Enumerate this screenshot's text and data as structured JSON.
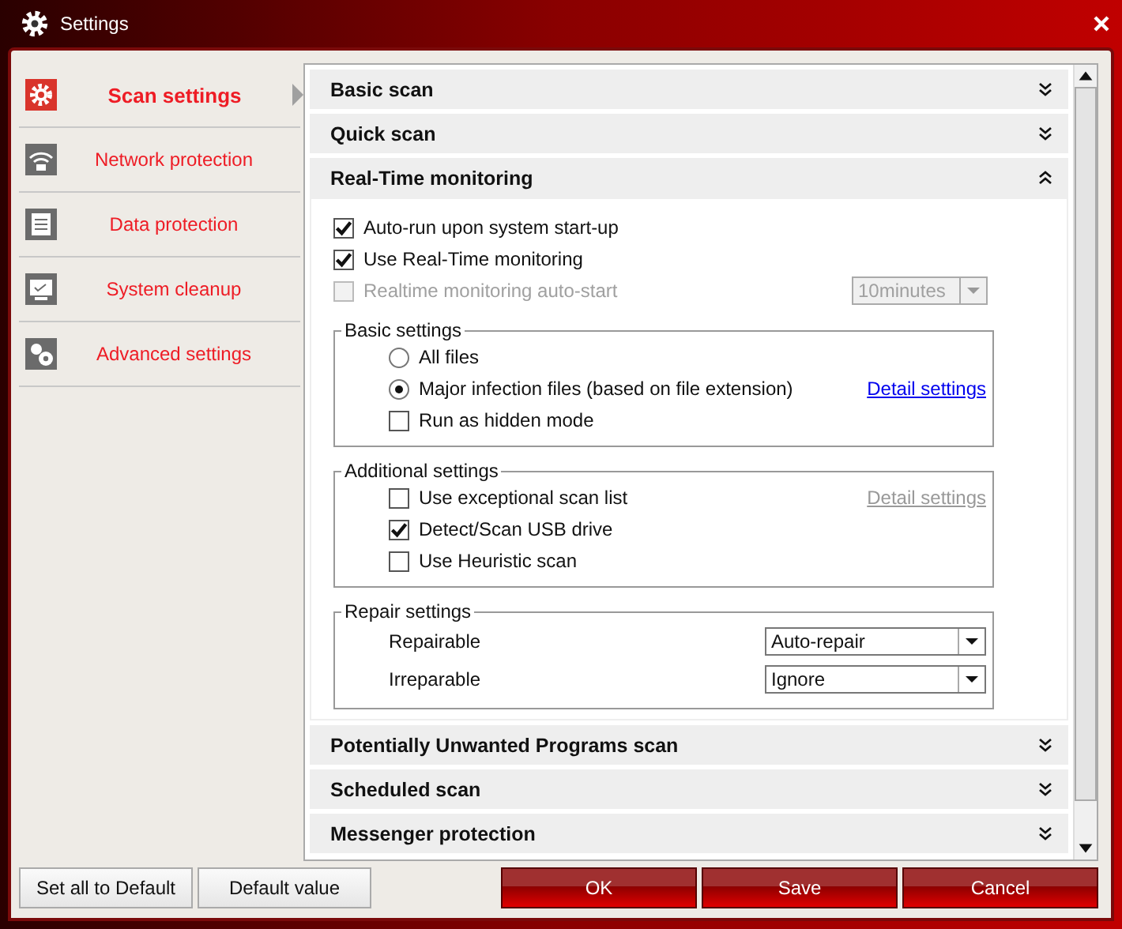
{
  "window": {
    "title": "Settings"
  },
  "sidebar": {
    "items": [
      {
        "label": "Scan settings",
        "selected": true
      },
      {
        "label": "Network protection",
        "selected": false
      },
      {
        "label": "Data protection",
        "selected": false
      },
      {
        "label": "System cleanup",
        "selected": false
      },
      {
        "label": "Advanced settings",
        "selected": false
      }
    ]
  },
  "sections": [
    {
      "title": "Basic scan",
      "expanded": false
    },
    {
      "title": "Quick scan",
      "expanded": false
    },
    {
      "title": "Real-Time monitoring",
      "expanded": true,
      "options": [
        {
          "label": "Auto-run upon system start-up",
          "checked": true,
          "disabled": false
        },
        {
          "label": "Use Real-Time monitoring",
          "checked": true,
          "disabled": false
        },
        {
          "label": "Realtime monitoring auto-start",
          "checked": false,
          "disabled": true,
          "select": "10minutes"
        }
      ],
      "groups": [
        {
          "title": "Basic settings",
          "rows": [
            {
              "kind": "radio",
              "label": "All files",
              "selected": false
            },
            {
              "kind": "radio",
              "label": "Major infection files (based on file extension)",
              "selected": true,
              "link": {
                "label": "Detail settings",
                "disabled": false
              }
            },
            {
              "kind": "checkbox",
              "label": "Run as hidden mode",
              "checked": false
            }
          ]
        },
        {
          "title": "Additional settings",
          "rows": [
            {
              "kind": "checkbox",
              "label": "Use exceptional scan list",
              "checked": false,
              "link": {
                "label": "Detail settings",
                "disabled": true
              }
            },
            {
              "kind": "checkbox",
              "label": "Detect/Scan USB drive",
              "checked": true
            },
            {
              "kind": "checkbox",
              "label": "Use Heuristic scan",
              "checked": false
            }
          ]
        },
        {
          "title": "Repair settings",
          "rows": [
            {
              "kind": "select",
              "label": "Repairable",
              "value": "Auto-repair"
            },
            {
              "kind": "select",
              "label": "Irreparable",
              "value": "Ignore"
            }
          ]
        }
      ]
    },
    {
      "title": "Potentially Unwanted Programs scan",
      "expanded": false
    },
    {
      "title": "Scheduled scan",
      "expanded": false
    },
    {
      "title": "Messenger protection",
      "expanded": false
    }
  ],
  "footer": {
    "left_buttons": [
      "Set all to Default",
      "Default value"
    ],
    "right_buttons": [
      "OK",
      "Save",
      "Cancel"
    ]
  }
}
